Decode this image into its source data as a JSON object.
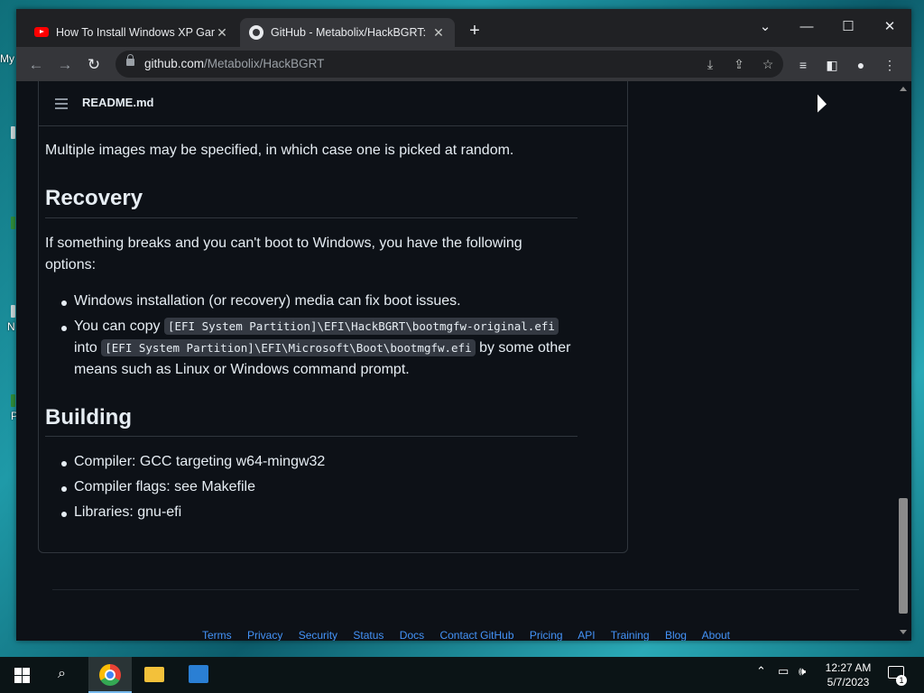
{
  "desktop": {
    "fragments": [
      "My",
      "N",
      "P"
    ]
  },
  "browser": {
    "tabs": [
      {
        "title": "How To Install Windows XP Gang",
        "active": false,
        "icon": "youtube-icon"
      },
      {
        "title": "GitHub - Metabolix/HackBGRT: W",
        "active": true,
        "icon": "github-icon"
      }
    ],
    "url_host": "github.com",
    "url_path": "/Metabolix/HackBGRT"
  },
  "readme": {
    "filename": "README.md",
    "intro": "Multiple images may be specified, in which case one is picked at random.",
    "recovery": {
      "heading": "Recovery",
      "text": "If something breaks and you can't boot to Windows, you have the following options:",
      "items": [
        {
          "text": "Windows installation (or recovery) media can fix boot issues."
        },
        {
          "prefix": "You can copy ",
          "code1": "[EFI System Partition]\\EFI\\HackBGRT\\bootmgfw-original.efi",
          "mid": "into ",
          "code2": "[EFI System Partition]\\EFI\\Microsoft\\Boot\\bootmgfw.efi",
          "suffix": " by some other means such as Linux or Windows command prompt."
        }
      ]
    },
    "building": {
      "heading": "Building",
      "items": [
        "Compiler: GCC targeting w64-mingw32",
        "Compiler flags: see Makefile",
        "Libraries: gnu-efi"
      ]
    }
  },
  "footer": {
    "links": [
      "Terms",
      "Privacy",
      "Security",
      "Status",
      "Docs",
      "Contact GitHub",
      "Pricing",
      "API",
      "Training",
      "Blog",
      "About"
    ]
  },
  "taskbar": {
    "time": "12:27 AM",
    "date": "5/7/2023",
    "notification_count": "1"
  }
}
